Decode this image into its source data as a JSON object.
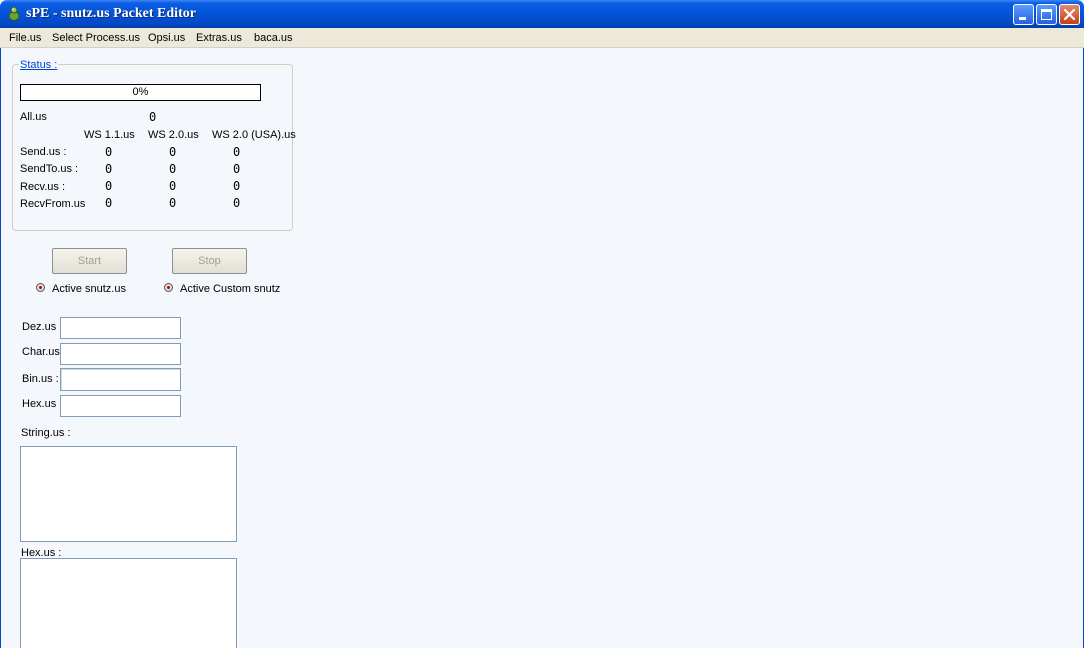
{
  "window": {
    "title": "sPE - snutz.us Packet Editor"
  },
  "menu": [
    {
      "label": "File.us"
    },
    {
      "label": "Select Process.us"
    },
    {
      "label": "Opsi.us"
    },
    {
      "label": "Extras.us"
    },
    {
      "label": "baca.us"
    }
  ],
  "status": {
    "legend": "Status :",
    "progress_text": "0%",
    "progress_value": 0,
    "all_label": "All.us",
    "all_value": "0",
    "columns": [
      "WS 1.1.us",
      "WS 2.0.us",
      "WS 2.0 (USA).us"
    ],
    "rows": [
      {
        "label": "Send.us :",
        "values": [
          "0",
          "0",
          "0"
        ]
      },
      {
        "label": "SendTo.us :",
        "values": [
          "0",
          "0",
          "0"
        ]
      },
      {
        "label": "Recv.us :",
        "values": [
          "0",
          "0",
          "0"
        ]
      },
      {
        "label": "RecvFrom.us",
        "values": [
          "0",
          "0",
          "0"
        ]
      }
    ]
  },
  "buttons": {
    "start": "Start",
    "stop": "Stop"
  },
  "radios": {
    "active_snutz": "Active snutz.us",
    "active_custom": "Active Custom snutz"
  },
  "converter": {
    "dez_label": "Dez.us :",
    "char_label": "Char.us",
    "bin_label": "Bin.us :",
    "hex_label": "Hex.us :",
    "dez_value": "",
    "char_value": "",
    "bin_value": "",
    "hex_value": "",
    "string_label": "String.us :",
    "hex_area_label": "Hex.us :"
  },
  "colors": {
    "titlebar": "#0453d8",
    "client_bg": "#f4f7fc",
    "legend": "#0046d5"
  }
}
